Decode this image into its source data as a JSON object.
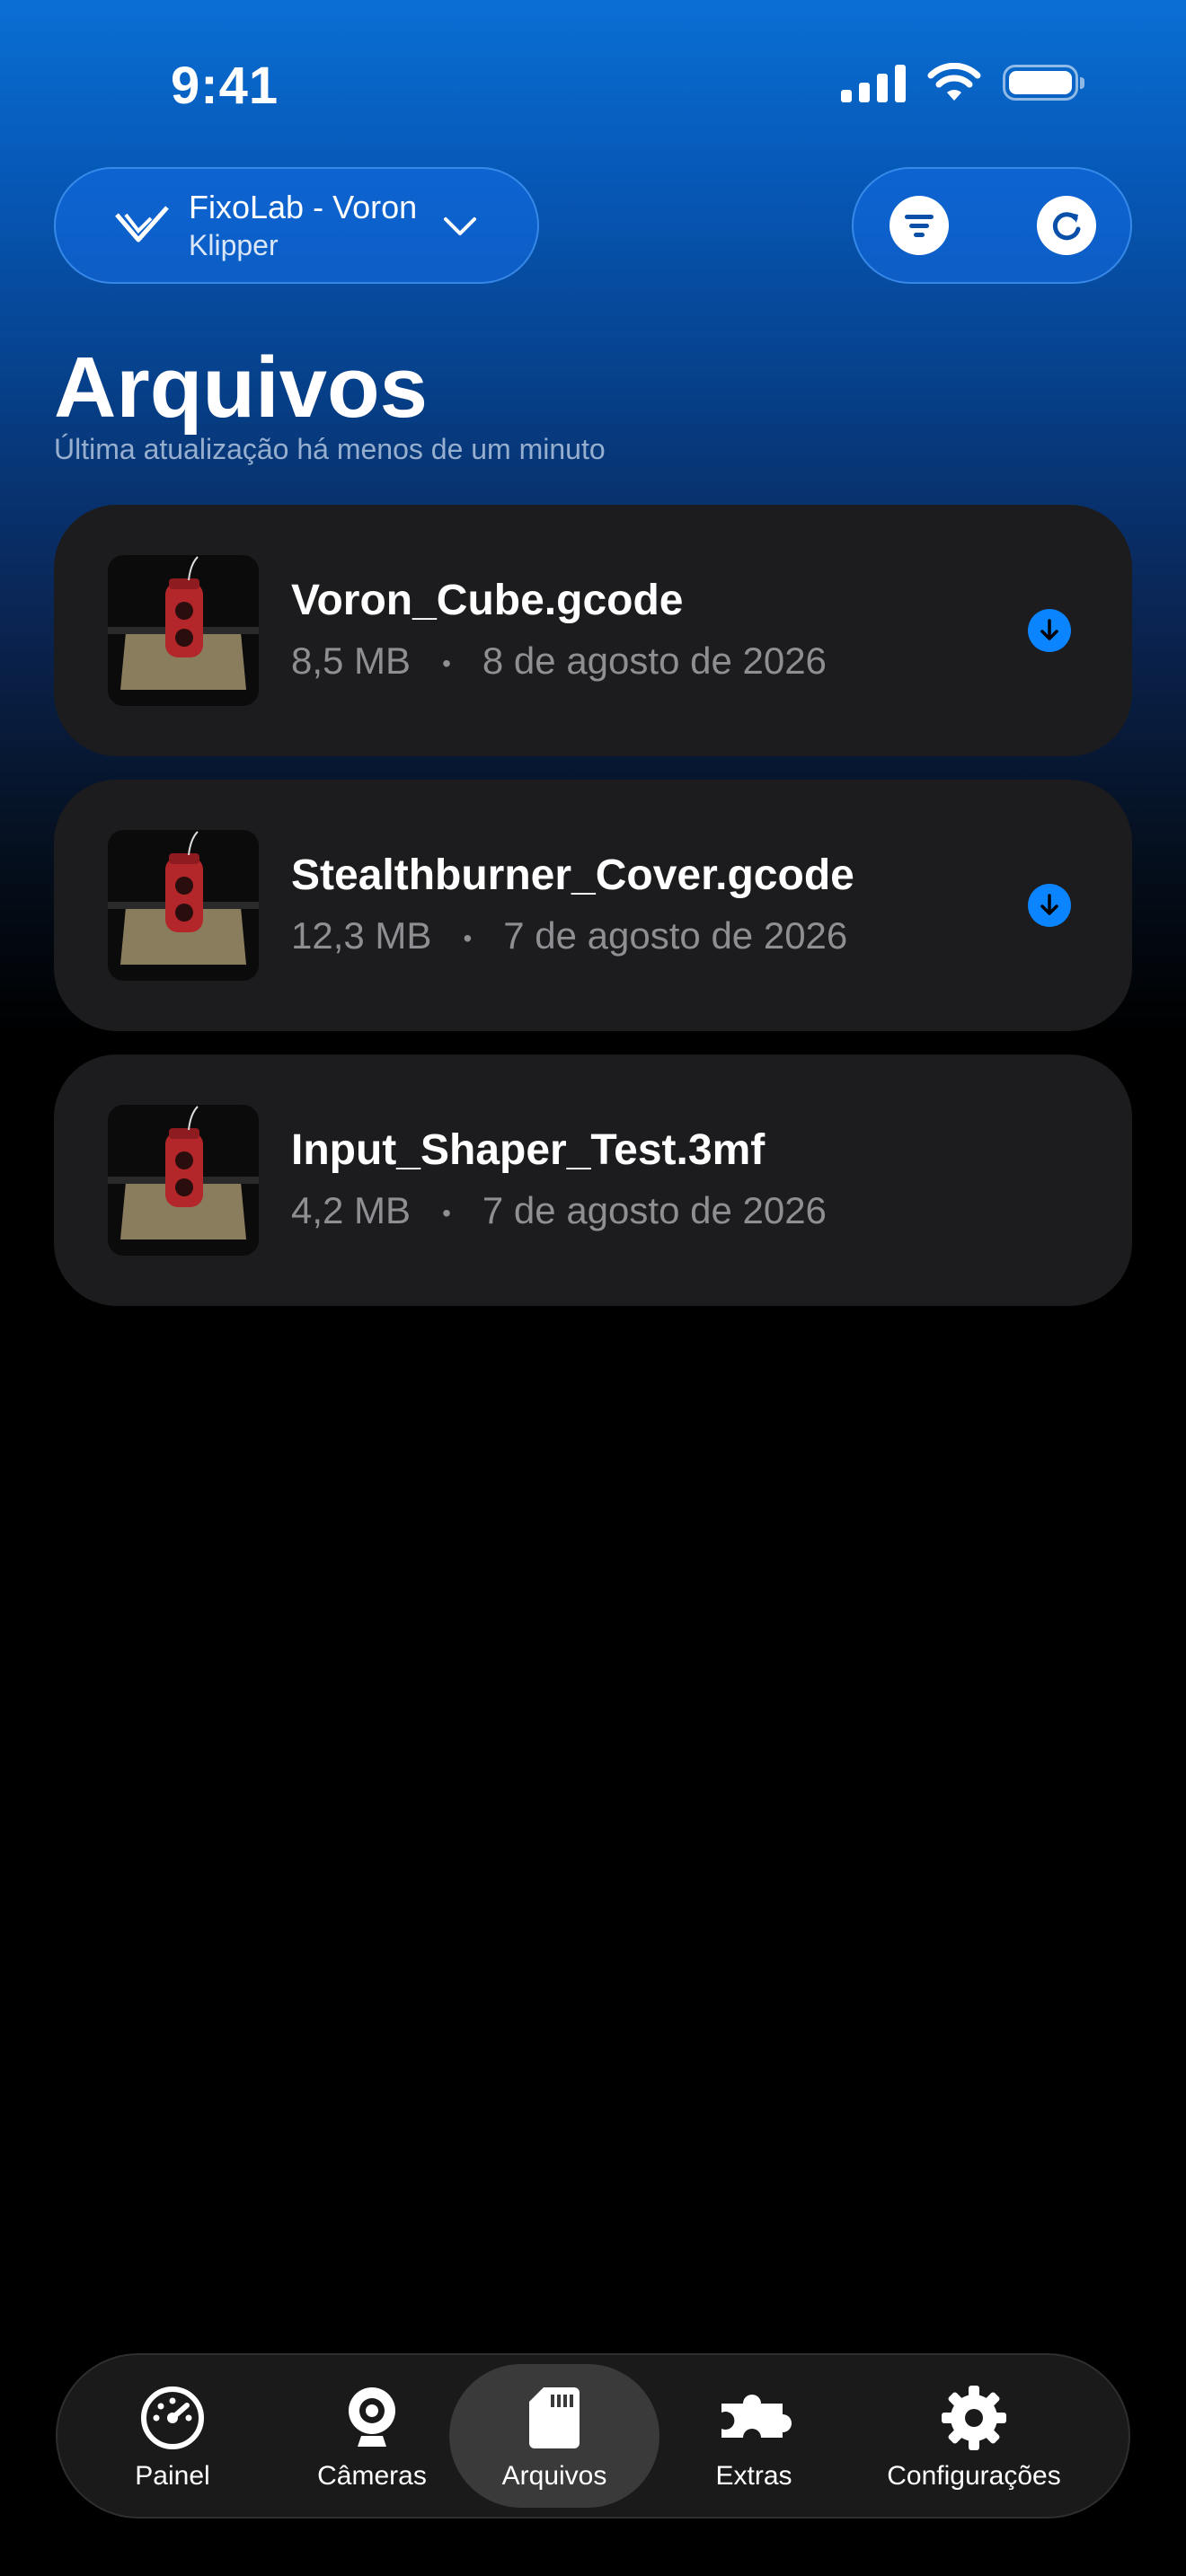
{
  "status_bar": {
    "time": "9:41"
  },
  "printer": {
    "name": "FixoLab - Voron",
    "firmware": "Klipper"
  },
  "page": {
    "title": "Arquivos",
    "subtitle": "Última atualização há menos de um minuto"
  },
  "files": [
    {
      "name": "Voron_Cube.gcode",
      "size": "8,5 MB",
      "date": "8 de agosto de 2026",
      "has_download": true
    },
    {
      "name": "Stealthburner_Cover.gcode",
      "size": "12,3 MB",
      "date": "7 de agosto de 2026",
      "has_download": true
    },
    {
      "name": "Input_Shaper_Test.3mf",
      "size": "4,2 MB",
      "date": "7 de agosto de 2026",
      "has_download": false
    }
  ],
  "meta_separator": "•",
  "tabs": [
    {
      "label": "Painel",
      "icon": "gauge-icon",
      "active": false
    },
    {
      "label": "Câmeras",
      "icon": "webcam-icon",
      "active": false
    },
    {
      "label": "Arquivos",
      "icon": "sd-card-icon",
      "active": true
    },
    {
      "label": "Extras",
      "icon": "puzzle-icon",
      "active": false
    },
    {
      "label": "Configurações",
      "icon": "gear-icon",
      "active": false
    }
  ],
  "colors": {
    "accent": "#0a84ff",
    "card": "#1c1c1e",
    "secondary_text": "#8e8e93"
  }
}
